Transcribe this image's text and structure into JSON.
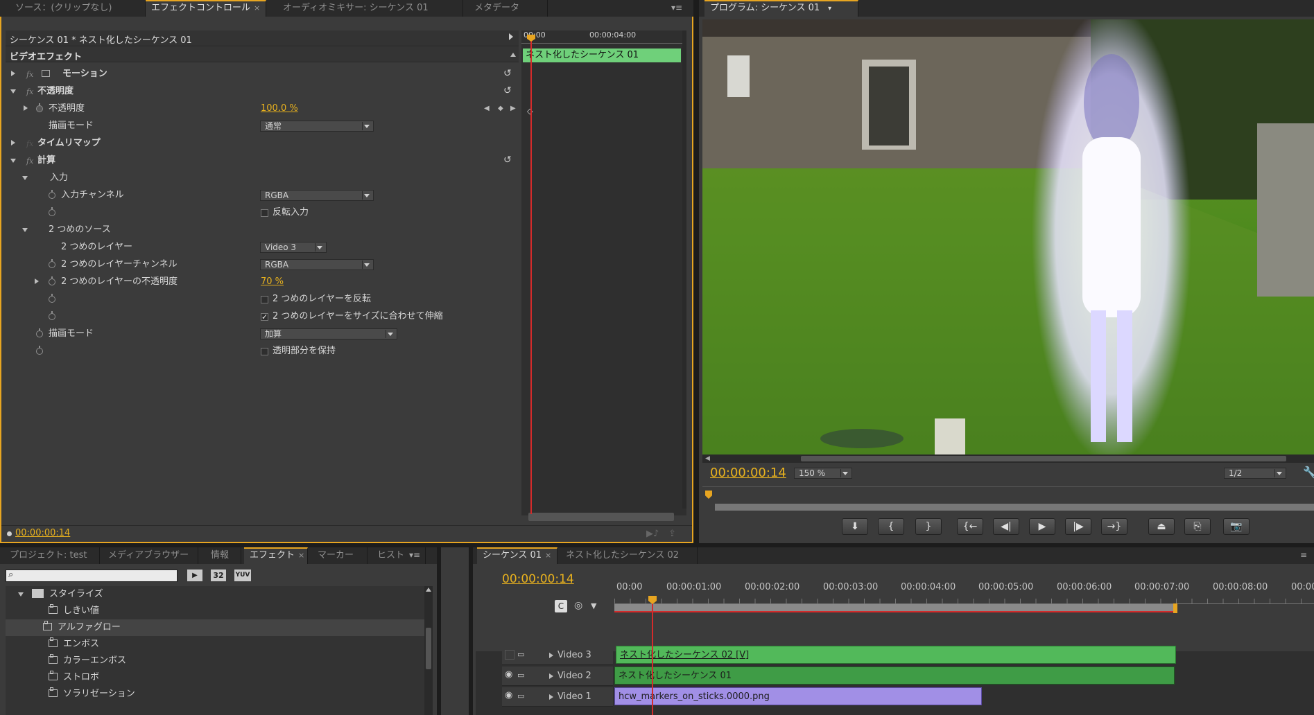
{
  "colors": {
    "accent": "#e7a521",
    "timecode": "#e9b21e",
    "clip_green": "#4caf50",
    "clip_purple": "#9d8ee0",
    "playhead": "#d42b2b"
  },
  "top_left_tabs": [
    {
      "label": "ソース：(クリップなし)"
    },
    {
      "label": "エフェクトコントロール",
      "active": true,
      "close": "×"
    },
    {
      "label": "オーディオミキサー: シーケンス 01"
    },
    {
      "label": "メタデータ"
    }
  ],
  "effect_controls": {
    "header_title": "シーケンス 01 * ネスト化したシーケンス 01",
    "mini_ruler_start": "00:00",
    "mini_ruler_mid": "00:00:04:00",
    "mini_clip_label": "ネスト化したシーケンス 01",
    "section_title": "ビデオエフェクト",
    "rows": {
      "motion": "モーション",
      "opacity": "不透明度",
      "opacity_param": "不透明度",
      "opacity_value": "100.0 %",
      "blend_mode": "描画モード",
      "blend_mode_value": "通常",
      "time_remap": "タイムリマップ",
      "calc": "計算",
      "input": "入力",
      "input_channel": "入力チャンネル",
      "input_channel_value": "RGBA",
      "invert_input": "反転入力",
      "second_source": "2 つめのソース",
      "second_layer": "2 つめのレイヤー",
      "second_layer_value": "Video 3",
      "second_layer_channel": "2 つめのレイヤーチャンネル",
      "second_layer_channel_value": "RGBA",
      "second_layer_opacity": "2 つめのレイヤーの不透明度",
      "second_layer_opacity_value": "70 %",
      "invert_second_layer": "2 つめのレイヤーを反転",
      "stretch_second_layer": "2 つめのレイヤーをサイズに合わせて伸縮",
      "calc_blend_mode": "描画モード",
      "calc_blend_mode_value": "加算",
      "preserve_transparency": "透明部分を保持"
    },
    "footer_timecode": "00:00:00:14"
  },
  "program_monitor": {
    "tab_label": "プログラム: シーケンス 01",
    "timecode": "00:00:00:14",
    "zoom": "150 %",
    "resolution": "1/2"
  },
  "bottom_left_tabs": [
    {
      "label": "プロジェクト: test"
    },
    {
      "label": "メディアブラウザー"
    },
    {
      "label": "情報"
    },
    {
      "label": "エフェクト",
      "active": true,
      "close": "×"
    },
    {
      "label": "マーカー"
    },
    {
      "label": "ヒスト"
    }
  ],
  "effects_panel": {
    "search_placeholder": "",
    "badges": [
      "32",
      "YUV"
    ],
    "folder": "スタイライズ",
    "items": [
      "しきい値",
      "アルファグロー",
      "エンボス",
      "カラーエンボス",
      "ストロボ",
      "ソラリゼーション"
    ]
  },
  "timeline": {
    "tabs": [
      {
        "label": "シーケンス 01",
        "active": true,
        "close": "×"
      },
      {
        "label": "ネスト化したシーケンス 02"
      }
    ],
    "timecode": "00:00:00:14",
    "ruler": [
      "00:00",
      "00:00:01:00",
      "00:00:02:00",
      "00:00:03:00",
      "00:00:04:00",
      "00:00:05:00",
      "00:00:06:00",
      "00:00:07:00",
      "00:00:08:00",
      "00:00"
    ],
    "tracks": [
      {
        "name": "Video 3",
        "clip": "ネスト化したシーケンス 02 [V]"
      },
      {
        "name": "Video 2",
        "clip": "ネスト化したシーケンス 01"
      },
      {
        "name": "Video 1",
        "clip": "hcw_markers_on_sticks.0000.png"
      }
    ]
  }
}
